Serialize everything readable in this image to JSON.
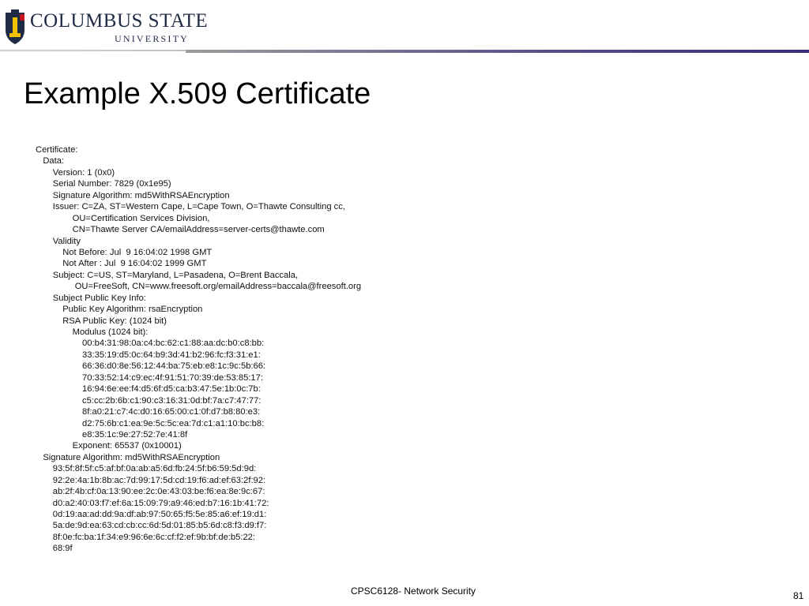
{
  "header": {
    "logo_top": "COLUMBUS STATE",
    "logo_bottom": "UNIVERSITY",
    "logo_icon": "shield-icon"
  },
  "slide": {
    "title": "Example X.509 Certificate",
    "certificate_lines": [
      "Certificate:",
      "   Data:",
      "       Version: 1 (0x0)",
      "       Serial Number: 7829 (0x1e95)",
      "       Signature Algorithm: md5WithRSAEncryption",
      "       Issuer: C=ZA, ST=Western Cape, L=Cape Town, O=Thawte Consulting cc,",
      "               OU=Certification Services Division,",
      "               CN=Thawte Server CA/emailAddress=server-certs@thawte.com",
      "       Validity",
      "           Not Before: Jul  9 16:04:02 1998 GMT",
      "           Not After : Jul  9 16:04:02 1999 GMT",
      "       Subject: C=US, ST=Maryland, L=Pasadena, O=Brent Baccala,",
      "                OU=FreeSoft, CN=www.freesoft.org/emailAddress=baccala@freesoft.org",
      "       Subject Public Key Info:",
      "           Public Key Algorithm: rsaEncryption",
      "           RSA Public Key: (1024 bit)",
      "               Modulus (1024 bit):",
      "                   00:b4:31:98:0a:c4:bc:62:c1:88:aa:dc:b0:c8:bb:",
      "                   33:35:19:d5:0c:64:b9:3d:41:b2:96:fc:f3:31:e1:",
      "                   66:36:d0:8e:56:12:44:ba:75:eb:e8:1c:9c:5b:66:",
      "                   70:33:52:14:c9:ec:4f:91:51:70:39:de:53:85:17:",
      "                   16:94:6e:ee:f4:d5:6f:d5:ca:b3:47:5e:1b:0c:7b:",
      "                   c5:cc:2b:6b:c1:90:c3:16:31:0d:bf:7a:c7:47:77:",
      "                   8f:a0:21:c7:4c:d0:16:65:00:c1:0f:d7:b8:80:e3:",
      "                   d2:75:6b:c1:ea:9e:5c:5c:ea:7d:c1:a1:10:bc:b8:",
      "                   e8:35:1c:9e:27:52:7e:41:8f",
      "               Exponent: 65537 (0x10001)",
      "   Signature Algorithm: md5WithRSAEncryption",
      "       93:5f:8f:5f:c5:af:bf:0a:ab:a5:6d:fb:24:5f:b6:59:5d:9d:",
      "       92:2e:4a:1b:8b:ac:7d:99:17:5d:cd:19:f6:ad:ef:63:2f:92:",
      "       ab:2f:4b:cf:0a:13:90:ee:2c:0e:43:03:be:f6:ea:8e:9c:67:",
      "       d0:a2:40:03:f7:ef:6a:15:09:79:a9:46:ed:b7:16:1b:41:72:",
      "       0d:19:aa:ad:dd:9a:df:ab:97:50:65:f5:5e:85:a6:ef:19:d1:",
      "       5a:de:9d:ea:63:cd:cb:cc:6d:5d:01:85:b5:6d:c8:f3:d9:f7:",
      "       8f:0e:fc:ba:1f:34:e9:96:6e:6c:cf:f2:ef:9b:bf:de:b5:22:",
      "       68:9f"
    ]
  },
  "footer": {
    "course": "CPSC6128- Network Security",
    "page_number": "81"
  }
}
